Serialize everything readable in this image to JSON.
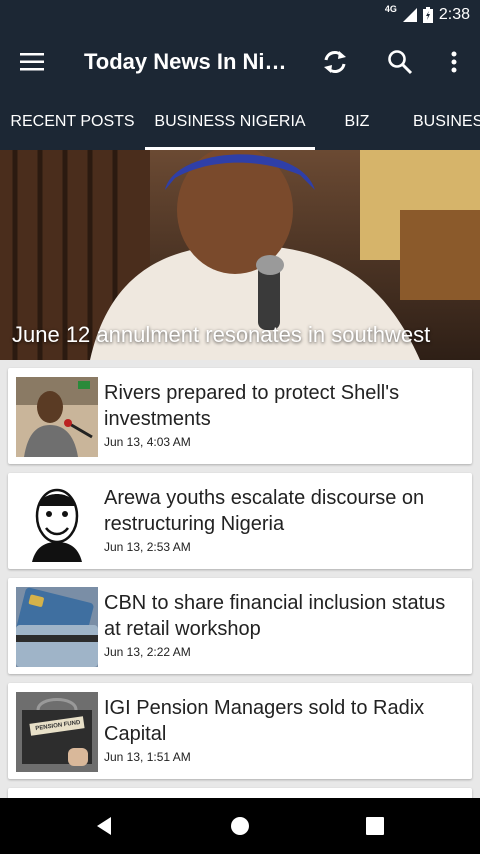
{
  "status_bar": {
    "network": "4G",
    "time": "2:38"
  },
  "toolbar": {
    "title": "Today News In Ni…",
    "icons": [
      "menu-icon",
      "refresh-icon",
      "search-icon",
      "more-vert-icon"
    ]
  },
  "tabs": [
    {
      "label": "RECENT POSTS",
      "active": false
    },
    {
      "label": "BUSINESS NIGERIA",
      "active": true
    },
    {
      "label": "BIZ",
      "active": false
    },
    {
      "label": "BUSINES",
      "active": false
    }
  ],
  "hero": {
    "caption": "June 12 annulment resonates in southwest"
  },
  "articles": [
    {
      "title": "Rivers prepared to protect Shell's investments",
      "date": "Jun 13, 4:03 AM"
    },
    {
      "title": "Arewa youths escalate discourse on restructuring Nigeria",
      "date": "Jun 13, 2:53 AM"
    },
    {
      "title": "CBN to share financial inclusion status at retail workshop",
      "date": "Jun 13, 2:22 AM"
    },
    {
      "title": "IGI Pension Managers sold to Radix Capital",
      "date": "Jun 13, 1:51 AM",
      "thumb_label": "PENSION FUND"
    }
  ],
  "nav_bar": {
    "icons": [
      "back-icon",
      "home-icon",
      "recents-icon"
    ]
  },
  "colors": {
    "toolbar": "#1c2734",
    "background": "#e8e8e8",
    "card": "#ffffff"
  }
}
